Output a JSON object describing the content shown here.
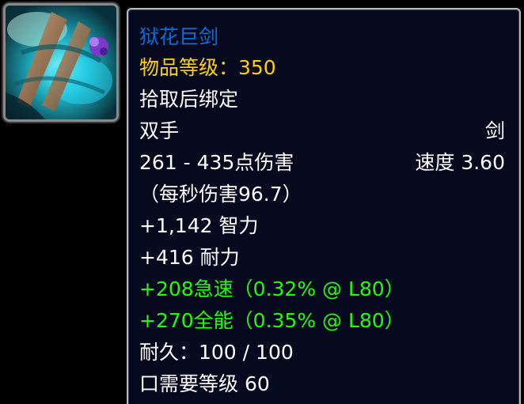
{
  "item": {
    "name": "狱花巨剑",
    "item_level": "物品等级：350",
    "binding": "拾取后绑定",
    "slot": "双手",
    "type": "剑",
    "damage": "261 - 435点伤害",
    "speed": "速度 3.60",
    "dps": "（每秒伤害96.7）",
    "stat_int": "+1,142 智力",
    "stat_sta": "+416 耐力",
    "stat_haste": "+208急速（0.32% @ L80）",
    "stat_vers": "+270全能（0.35% @ L80）",
    "durability": "耐久：100 / 100",
    "required_level": "口需要等级 60"
  },
  "icon": {
    "name": "sword-item-icon"
  },
  "colors": {
    "quality_rare": "#0070dd",
    "item_level": "#ffd100",
    "bonus_stat": "#1eff00",
    "tooltip_bg": "#070a1e",
    "tooltip_border": "#b9b9b9"
  }
}
